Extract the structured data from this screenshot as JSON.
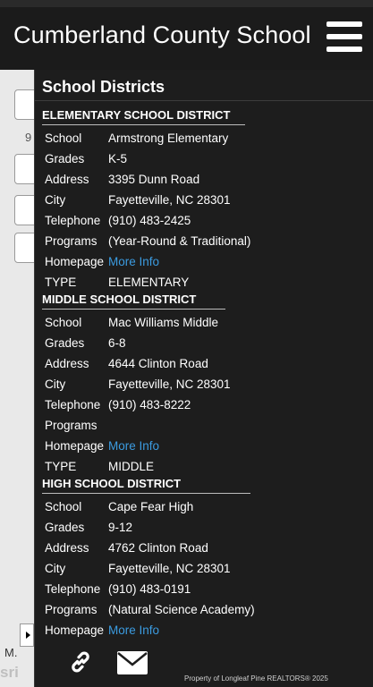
{
  "header": {
    "title": "Cumberland County School"
  },
  "map": {
    "number_label": "9",
    "bottom_text": "M.",
    "logo_text": "sri"
  },
  "panel": {
    "title": "School Districts",
    "sections": [
      {
        "heading": "ELEMENTARY SCHOOL DISTRICT",
        "rows": [
          {
            "label": "School",
            "value": "Armstrong Elementary"
          },
          {
            "label": "Grades",
            "value": "K-5"
          },
          {
            "label": "Address",
            "value": "3395 Dunn Road"
          },
          {
            "label": "City",
            "value": "Fayetteville, NC 28301"
          },
          {
            "label": "Telephone",
            "value": "(910) 483-2425"
          },
          {
            "label": "Programs",
            "value": "(Year-Round & Traditional)"
          },
          {
            "label": "Homepage",
            "value": "More Info"
          },
          {
            "label": "TYPE",
            "value": "ELEMENTARY"
          }
        ]
      },
      {
        "heading": "MIDDLE SCHOOL DISTRICT",
        "rows": [
          {
            "label": "School",
            "value": "Mac Williams Middle"
          },
          {
            "label": "Grades",
            "value": "6-8"
          },
          {
            "label": "Address",
            "value": "4644 Clinton Road"
          },
          {
            "label": "City",
            "value": "Fayetteville, NC 28301"
          },
          {
            "label": "Telephone",
            "value": "(910) 483-8222"
          },
          {
            "label": "Programs",
            "value": ""
          },
          {
            "label": "Homepage",
            "value": "More Info"
          },
          {
            "label": "TYPE",
            "value": "MIDDLE"
          }
        ]
      },
      {
        "heading": "HIGH SCHOOL DISTRICT",
        "rows": [
          {
            "label": "School",
            "value": "Cape Fear High"
          },
          {
            "label": "Grades",
            "value": "9-12"
          },
          {
            "label": "Address",
            "value": "4762 Clinton Road"
          },
          {
            "label": "City",
            "value": "Fayetteville, NC 28301"
          },
          {
            "label": "Telephone",
            "value": "(910) 483-0191"
          },
          {
            "label": "Programs",
            "value": "(Natural Science Academy)"
          },
          {
            "label": "Homepage",
            "value": "More Info"
          }
        ]
      }
    ]
  },
  "footer": {
    "copyright": "Property of Longleaf Pine REALTORS®  2025",
    "icons": [
      "link-icon",
      "mail-icon"
    ]
  },
  "colors": {
    "panel_bg": "#1d1d1d",
    "link": "#3b9be0",
    "header_bg": "#1b1b1b"
  }
}
